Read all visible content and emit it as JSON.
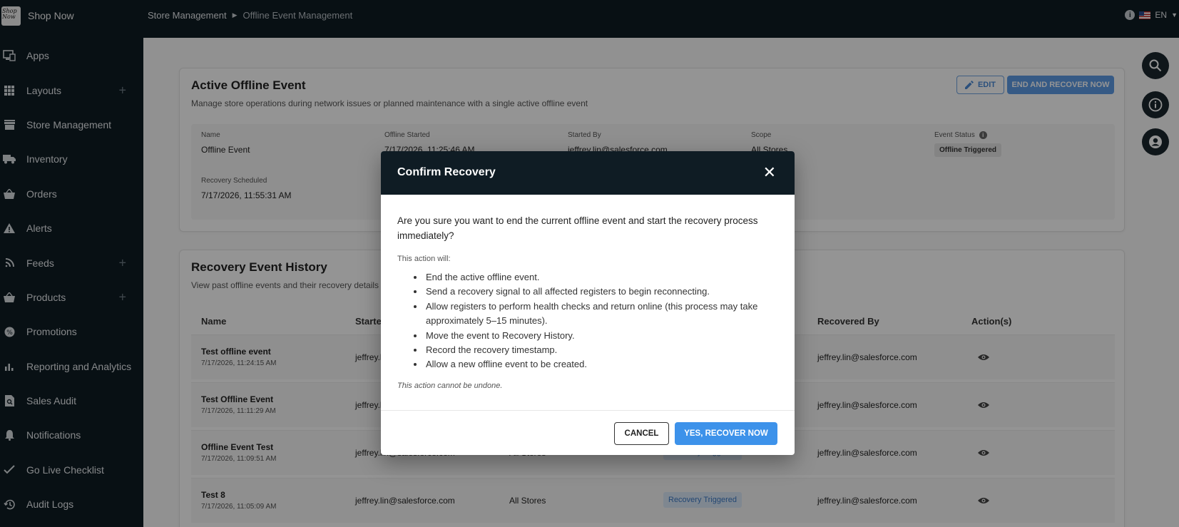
{
  "app": {
    "name": "Shop Now",
    "logo_text": "Shop Now"
  },
  "sidebar": {
    "items": [
      {
        "label": "Apps",
        "icon": "monitor-icon",
        "plus": false
      },
      {
        "label": "Layouts",
        "icon": "grid-icon",
        "plus": true
      },
      {
        "label": "Store Management",
        "icon": "store-icon",
        "plus": false
      },
      {
        "label": "Inventory",
        "icon": "truck-icon",
        "plus": false
      },
      {
        "label": "Orders",
        "icon": "basket-icon",
        "plus": false
      },
      {
        "label": "Alerts",
        "icon": "warning-icon",
        "plus": false
      },
      {
        "label": "Feeds",
        "icon": "rss-icon",
        "plus": true
      },
      {
        "label": "Products",
        "icon": "basket-icon",
        "plus": true
      },
      {
        "label": "Promotions",
        "icon": "badge-icon",
        "plus": false
      },
      {
        "label": "Reporting and Analytics",
        "icon": "bar-chart-icon",
        "plus": false
      },
      {
        "label": "Sales Audit",
        "icon": "document-search-icon",
        "plus": false
      },
      {
        "label": "Notifications",
        "icon": "bell-icon",
        "plus": false
      },
      {
        "label": "Go Live Checklist",
        "icon": "check-icon",
        "plus": false
      },
      {
        "label": "Audit Logs",
        "icon": "history-icon",
        "plus": false
      }
    ]
  },
  "header": {
    "breadcrumb": {
      "parent": "Store Management",
      "current": "Offline Event Management"
    },
    "language": "EN"
  },
  "active_event": {
    "title": "Active Offline Event",
    "subtitle": "Manage store operations during network issues or planned maintenance with a single active offline event",
    "edit_label": "EDIT",
    "end_label": "END AND RECOVER NOW",
    "fields": {
      "name_label": "Name",
      "name_value": "Offline Event",
      "started_label": "Offline Started",
      "started_value": "7/17/2026, 11:25:46 AM",
      "by_label": "Started By",
      "by_value": "jeffrey.lin@salesforce.com",
      "scope_label": "Scope",
      "scope_value": "All Stores",
      "status_label": "Event Status",
      "status_value": "Offline Triggered",
      "recovery_label": "Recovery Scheduled",
      "recovery_value": "7/17/2026, 11:55:31 AM"
    }
  },
  "history": {
    "title": "Recovery Event History",
    "subtitle": "View past offline events and their recovery details",
    "columns": {
      "name": "Name",
      "started": "Started By",
      "recovered_by": "Recovered By",
      "actions": "Action(s)"
    },
    "rows": [
      {
        "name": "Test offline event",
        "date": "7/17/2026, 11:24:15 AM",
        "started_by": "jeffrey.lin@salesforce.com",
        "scope": "",
        "status": "",
        "recovered_by": "jeffrey.lin@salesforce.com"
      },
      {
        "name": "Test Offline Event",
        "date": "7/17/2026, 11:11:29 AM",
        "started_by": "jeffrey.lin@salesforce.com",
        "scope": "",
        "status": "",
        "recovered_by": "jeffrey.lin@salesforce.com"
      },
      {
        "name": "Offline Event Test",
        "date": "7/17/2026, 11:09:51 AM",
        "started_by": "jeffrey.lin@salesforce.com",
        "scope": "All Stores",
        "status": "Recovery Triggered",
        "recovered_by": "jeffrey.lin@salesforce.com"
      },
      {
        "name": "Test 8",
        "date": "7/17/2026, 11:05:09 AM",
        "started_by": "jeffrey.lin@salesforce.com",
        "scope": "All Stores",
        "status": "Recovery Triggered",
        "recovered_by": "jeffrey.lin@salesforce.com"
      }
    ]
  },
  "dialog": {
    "title": "Confirm Recovery",
    "question": "Are you sure you want to end the current offline event and start the recovery process immediately?",
    "action_label": "This action will:",
    "actions": [
      "End the active offline event.",
      "Send a recovery signal to all affected registers to begin reconnecting.",
      "Allow registers to perform health checks and return online (this process may take approximately 5–15 minutes).",
      "Move the event to Recovery History.",
      "Record the recovery timestamp.",
      "Allow a new offline event to be created."
    ],
    "note": "This action cannot be undone.",
    "cancel_label": "CANCEL",
    "confirm_label": "YES, RECOVER NOW"
  },
  "colors": {
    "sidebar": "#0f1c24",
    "primary": "#3d92ea",
    "chip": "#dbe8f8"
  }
}
